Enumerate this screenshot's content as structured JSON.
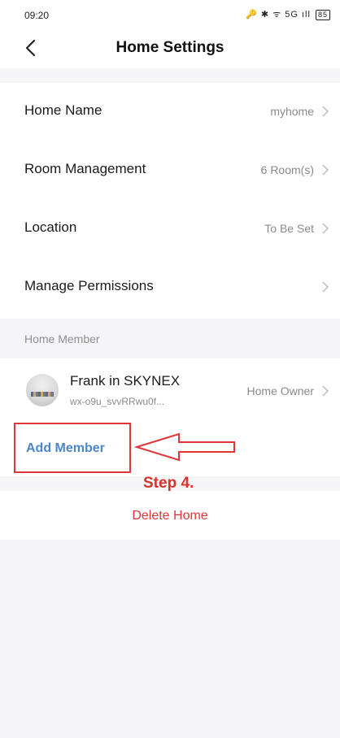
{
  "status_bar": {
    "time": "09:20",
    "icons": "🔑 ✱ ᯤ 5G ıll",
    "battery": "85"
  },
  "header": {
    "title": "Home Settings",
    "back_icon": "chevron-left-icon"
  },
  "settings": {
    "items": [
      {
        "label": "Home Name",
        "value": "myhome"
      },
      {
        "label": "Room Management",
        "value": "6 Room(s)"
      },
      {
        "label": "Location",
        "value": "To Be Set"
      },
      {
        "label": "Manage Permissions",
        "value": ""
      }
    ]
  },
  "members": {
    "section_label": "Home Member",
    "items": [
      {
        "name": "Frank in SKYNEX",
        "id": "wx-o9u_svvRRwu0f...",
        "role": "Home Owner"
      }
    ],
    "add_label": "Add Member"
  },
  "annotation": {
    "step_label": "Step 4.",
    "color": "#e0363a"
  },
  "delete_label": "Delete Home",
  "colors": {
    "accent_blue": "#4a86c9",
    "danger": "#e0363a",
    "background": "#f5f5f7"
  }
}
